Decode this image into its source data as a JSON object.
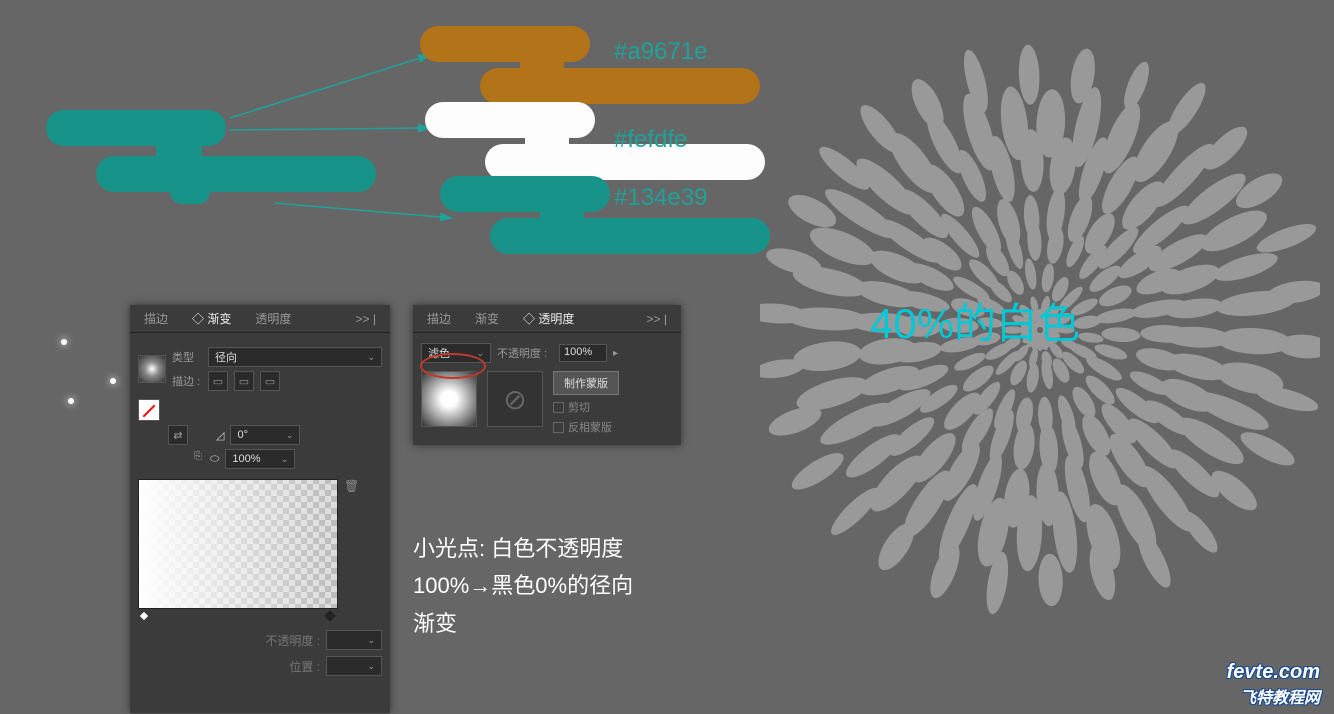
{
  "clouds": {
    "label1": "#a9671e",
    "label2": "#fefdfe",
    "label3": "#134e39"
  },
  "gradient_panel": {
    "tabs": {
      "stroke": "描边",
      "gradient": "◇ 渐变",
      "transparency": "透明度",
      "more": ">> |"
    },
    "type_label": "类型",
    "type_value": "径向",
    "stroke_label": "描边 :",
    "angle_label": "◿",
    "angle_value": "0°",
    "aspect_label": "⬭",
    "aspect_value": "100%",
    "opacity_label": "不透明度 :",
    "location_label": "位置 :"
  },
  "transparency_panel": {
    "tabs": {
      "stroke": "描边",
      "gradient": "渐变",
      "transparency": "◇ 透明度",
      "more": ">> |"
    },
    "blend_mode": "滤色",
    "opacity_label": "不透明度 :",
    "opacity_value": "100%",
    "make_mask": "制作蒙版",
    "clip": "剪切",
    "invert": "反相蒙版"
  },
  "description": {
    "line1": "小光点: 白色不透明度",
    "line2": "100%→黑色0%的径向",
    "line3": "渐变"
  },
  "overlay": "40%的白色",
  "watermark": {
    "site": "fevte.com",
    "name": "飞特教程网"
  }
}
